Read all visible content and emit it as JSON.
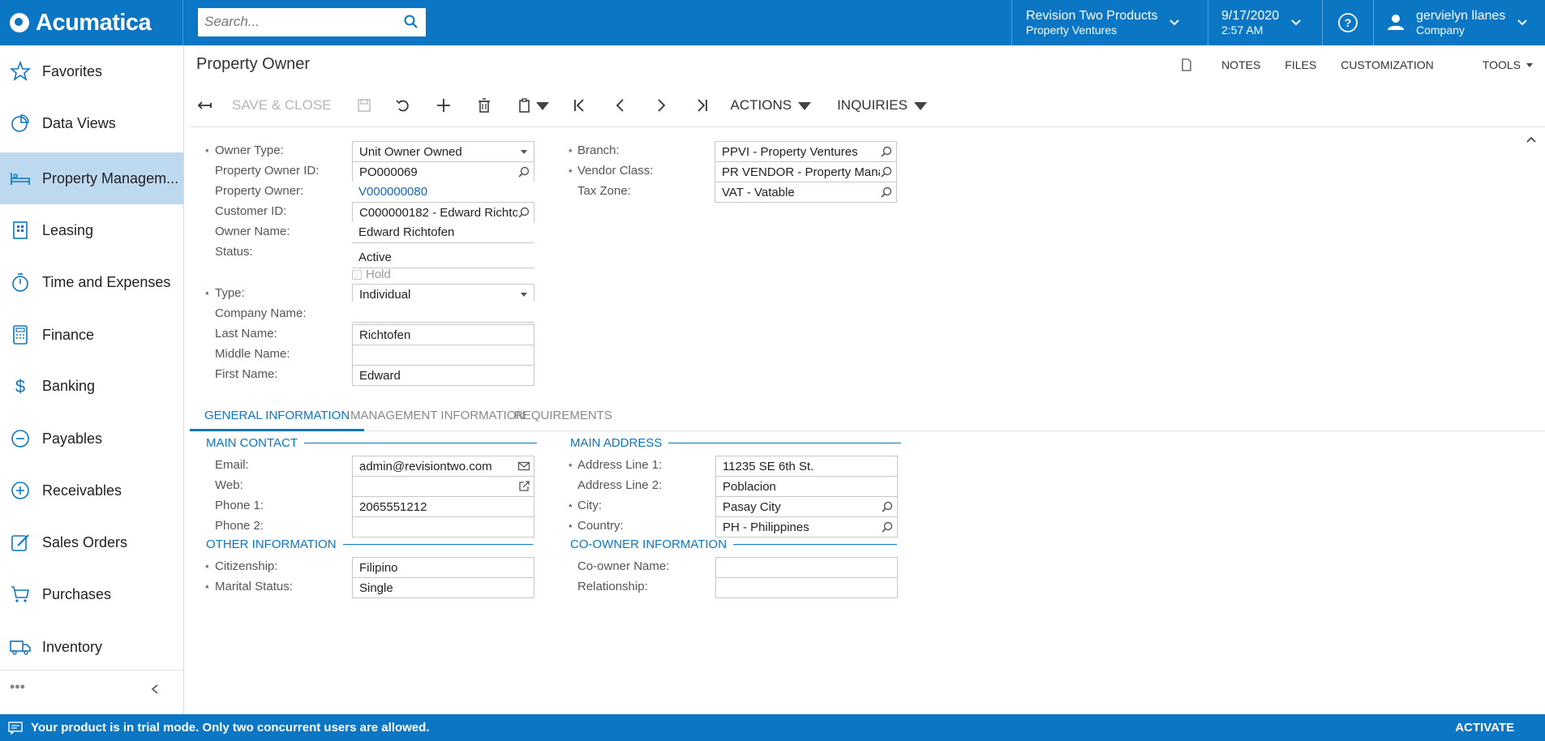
{
  "app": {
    "name": "Acumatica"
  },
  "search": {
    "placeholder": "Search..."
  },
  "header": {
    "company": "Revision Two Products",
    "branch": "Property Ventures",
    "date": "9/17/2020",
    "time": "2:57 AM",
    "user": "gervielyn llanes",
    "user_sub": "Company"
  },
  "sidebar": {
    "items": [
      {
        "label": "Favorites",
        "icon": "star-icon"
      },
      {
        "label": "Data Views",
        "icon": "pie-chart-icon"
      },
      {
        "label": "Property Managem...",
        "icon": "bed-icon"
      },
      {
        "label": "Leasing",
        "icon": "building-icon"
      },
      {
        "label": "Time and Expenses",
        "icon": "stopwatch-icon"
      },
      {
        "label": "Finance",
        "icon": "calculator-icon"
      },
      {
        "label": "Banking",
        "icon": "dollar-icon"
      },
      {
        "label": "Payables",
        "icon": "minus-circle-icon"
      },
      {
        "label": "Receivables",
        "icon": "plus-circle-icon"
      },
      {
        "label": "Sales Orders",
        "icon": "edit-icon"
      },
      {
        "label": "Purchases",
        "icon": "cart-icon"
      },
      {
        "label": "Inventory",
        "icon": "truck-icon"
      }
    ],
    "more": "•••"
  },
  "page": {
    "title": "Property Owner"
  },
  "top_links": {
    "notes": "NOTES",
    "files": "FILES",
    "customization": "CUSTOMIZATION",
    "tools": "TOOLS"
  },
  "toolbar": {
    "save_close": "SAVE & CLOSE",
    "actions": "ACTIONS",
    "inquiries": "INQUIRIES"
  },
  "form": {
    "owner_type": {
      "label": "Owner Type:",
      "value": "Unit Owner Owned"
    },
    "owner_id": {
      "label": "Property Owner ID:",
      "value": "PO000069"
    },
    "property_owner": {
      "label": "Property Owner:",
      "value": "V000000080"
    },
    "customer_id": {
      "label": "Customer ID:",
      "value": "C000000182 - Edward Richto"
    },
    "owner_name": {
      "label": "Owner Name:",
      "value": "Edward Richtofen"
    },
    "status": {
      "label": "Status:",
      "value": "Active"
    },
    "hold": {
      "label": "Hold"
    },
    "type": {
      "label": "Type:",
      "value": "Individual"
    },
    "company_name": {
      "label": "Company Name:",
      "value": ""
    },
    "last_name": {
      "label": "Last Name:",
      "value": "Richtofen"
    },
    "middle_name": {
      "label": "Middle Name:",
      "value": ""
    },
    "first_name": {
      "label": "First Name:",
      "value": "Edward"
    },
    "branch": {
      "label": "Branch:",
      "value": "PPVI - Property Ventures"
    },
    "vendor_class": {
      "label": "Vendor Class:",
      "value": "PR VENDOR - Property Mana"
    },
    "tax_zone": {
      "label": "Tax Zone:",
      "value": "VAT - Vatable"
    }
  },
  "tabs": [
    "GENERAL INFORMATION",
    "MANAGEMENT INFORMATION",
    "REQUIREMENTS"
  ],
  "general": {
    "main_contact": "MAIN CONTACT",
    "email": {
      "label": "Email:",
      "value": "admin@revisiontwo.com"
    },
    "web": {
      "label": "Web:",
      "value": ""
    },
    "phone1": {
      "label": "Phone 1:",
      "value": "2065551212"
    },
    "phone2": {
      "label": "Phone 2:",
      "value": ""
    },
    "other_info": "OTHER INFORMATION",
    "citizenship": {
      "label": "Citizenship:",
      "value": "Filipino"
    },
    "marital": {
      "label": "Marital Status:",
      "value": "Single"
    },
    "main_address": "MAIN ADDRESS",
    "addr1": {
      "label": "Address Line 1:",
      "value": "11235 SE 6th St."
    },
    "addr2": {
      "label": "Address Line 2:",
      "value": "Poblacion"
    },
    "city": {
      "label": "City:",
      "value": "Pasay City"
    },
    "country": {
      "label": "Country:",
      "value": "PH - Philippines"
    },
    "coowner_info": "CO-OWNER INFORMATION",
    "coowner_name": {
      "label": "Co-owner Name:",
      "value": ""
    },
    "relationship": {
      "label": "Relationship:",
      "value": ""
    }
  },
  "footer": {
    "message": "Your product is in trial mode. Only two concurrent users are allowed.",
    "activate": "ACTIVATE"
  },
  "colors": {
    "brand": "#0b76c4",
    "active_nav": "#bdd9f0",
    "link": "#1565c0"
  }
}
